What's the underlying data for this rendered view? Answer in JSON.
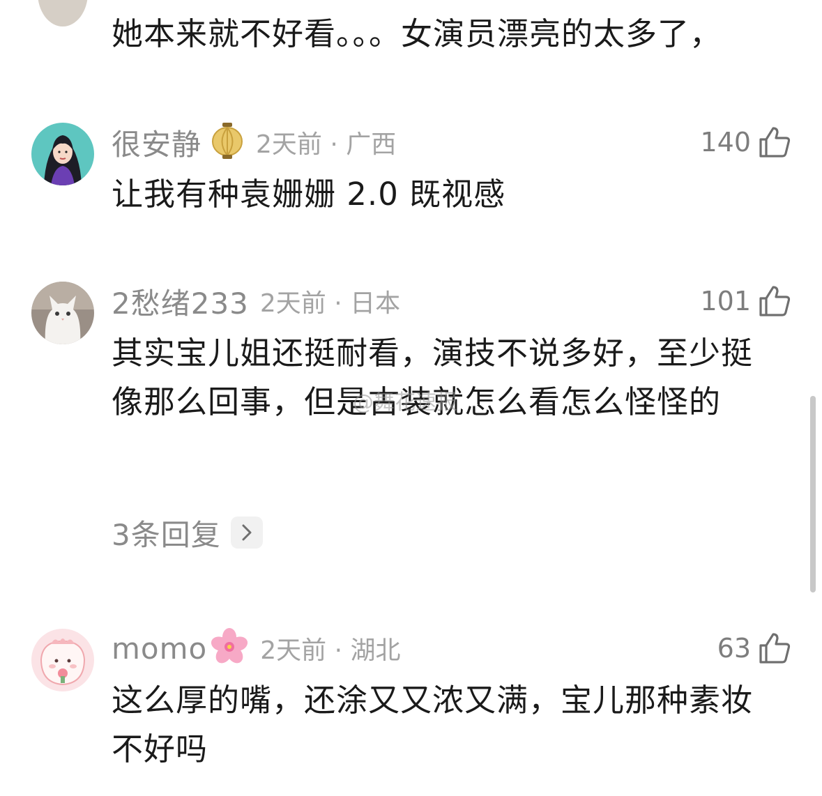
{
  "top_partial_comment": {
    "text": "她本来就不好看。。。女演员漂亮的太多了，"
  },
  "comments": [
    {
      "username": "很安静",
      "badge_icon": "lantern-icon",
      "time": "2天前",
      "location": "广西",
      "time_location": "2天前 · 广西",
      "likes": "140",
      "text": "让我有种袁姗姗 2.0 既视感"
    },
    {
      "username": "2愁绪233",
      "time": "2天前",
      "location": "日本",
      "time_location": "2天前 · 日本",
      "likes": "101",
      "text": "其实宝儿姐还挺耐看，演技不说多好，至少挺像那么回事，但是古装就怎么看怎么怪怪的",
      "replies_label": "3条回复"
    },
    {
      "username": "momo",
      "badge_icon": "cherry-blossom-icon",
      "time": "2天前",
      "location": "湖北",
      "time_location": "2天前 · 湖北",
      "likes": "63",
      "text": "这么厚的嘴，还涂又又浓又满，宝儿那种素妆不好吗"
    }
  ],
  "watermark": "@舞花速报",
  "colors": {
    "username": "#8a8a8a",
    "meta": "#a3a3a3",
    "text": "#1a1a1a",
    "scrollbar": "#c8c8c8"
  }
}
